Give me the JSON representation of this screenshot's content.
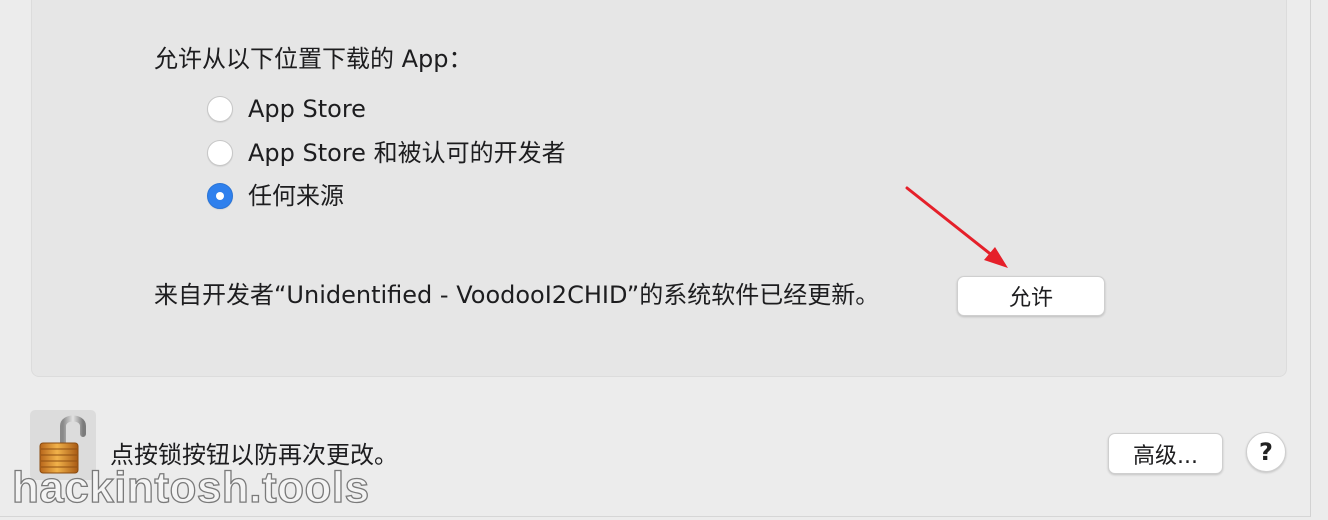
{
  "security": {
    "allow_apps_title": "允许从以下位置下载的 App：",
    "options": [
      {
        "label": "App Store",
        "checked": false
      },
      {
        "label": "App Store 和被认可的开发者",
        "checked": false
      },
      {
        "label": "任何来源",
        "checked": true
      }
    ],
    "blocked_notice": "来自开发者“Unidentified - VoodooI2CHID”的系统软件已经更新。",
    "allow_button": "允许"
  },
  "footer": {
    "lock_hint": "点按锁按钮以防再次更改。",
    "advanced_button": "高级...",
    "help_button": "?"
  },
  "watermark": "hackintosh.tools",
  "colors": {
    "accent": "#2f80ed",
    "annotation_arrow": "#e5202a"
  },
  "icons": {
    "lock": "unlocked-padlock-icon",
    "annotation": "red-arrow-annotation"
  }
}
